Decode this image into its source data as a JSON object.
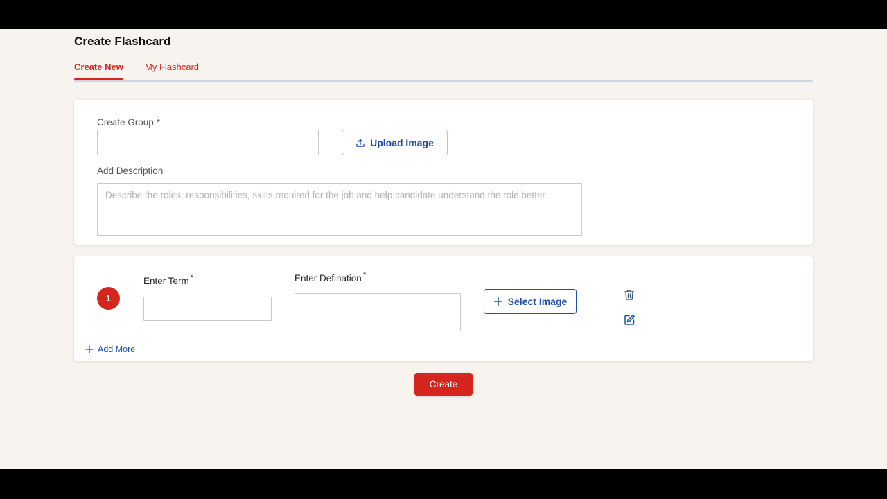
{
  "page": {
    "title": "Create Flashcard"
  },
  "tabs": [
    {
      "label": "Create New",
      "active": true
    },
    {
      "label": "My Flashcard",
      "active": false
    }
  ],
  "group_form": {
    "group_label": "Create Group",
    "required_mark": "*",
    "group_value": "",
    "upload_button": "Upload Image",
    "description_label": "Add Description",
    "description_placeholder": "Describe the roles, responsibilities, skills required for the job and help candidate understand the role better",
    "description_value": ""
  },
  "cards": [
    {
      "index": "1",
      "term_label": "Enter Term",
      "term_value": "",
      "definition_label": "Enter Defination",
      "definition_value": "",
      "select_image_button": "Select Image",
      "required_mark": "*"
    }
  ],
  "add_more_label": "Add More",
  "submit_button": "Create",
  "colors": {
    "accent_red": "#d4261f",
    "link_blue": "#1c4fa8",
    "page_background": "#f7f3ef"
  },
  "icons": {
    "upload": "upload-icon",
    "plus": "plus-icon",
    "delete": "trash-icon",
    "edit": "edit-icon"
  }
}
